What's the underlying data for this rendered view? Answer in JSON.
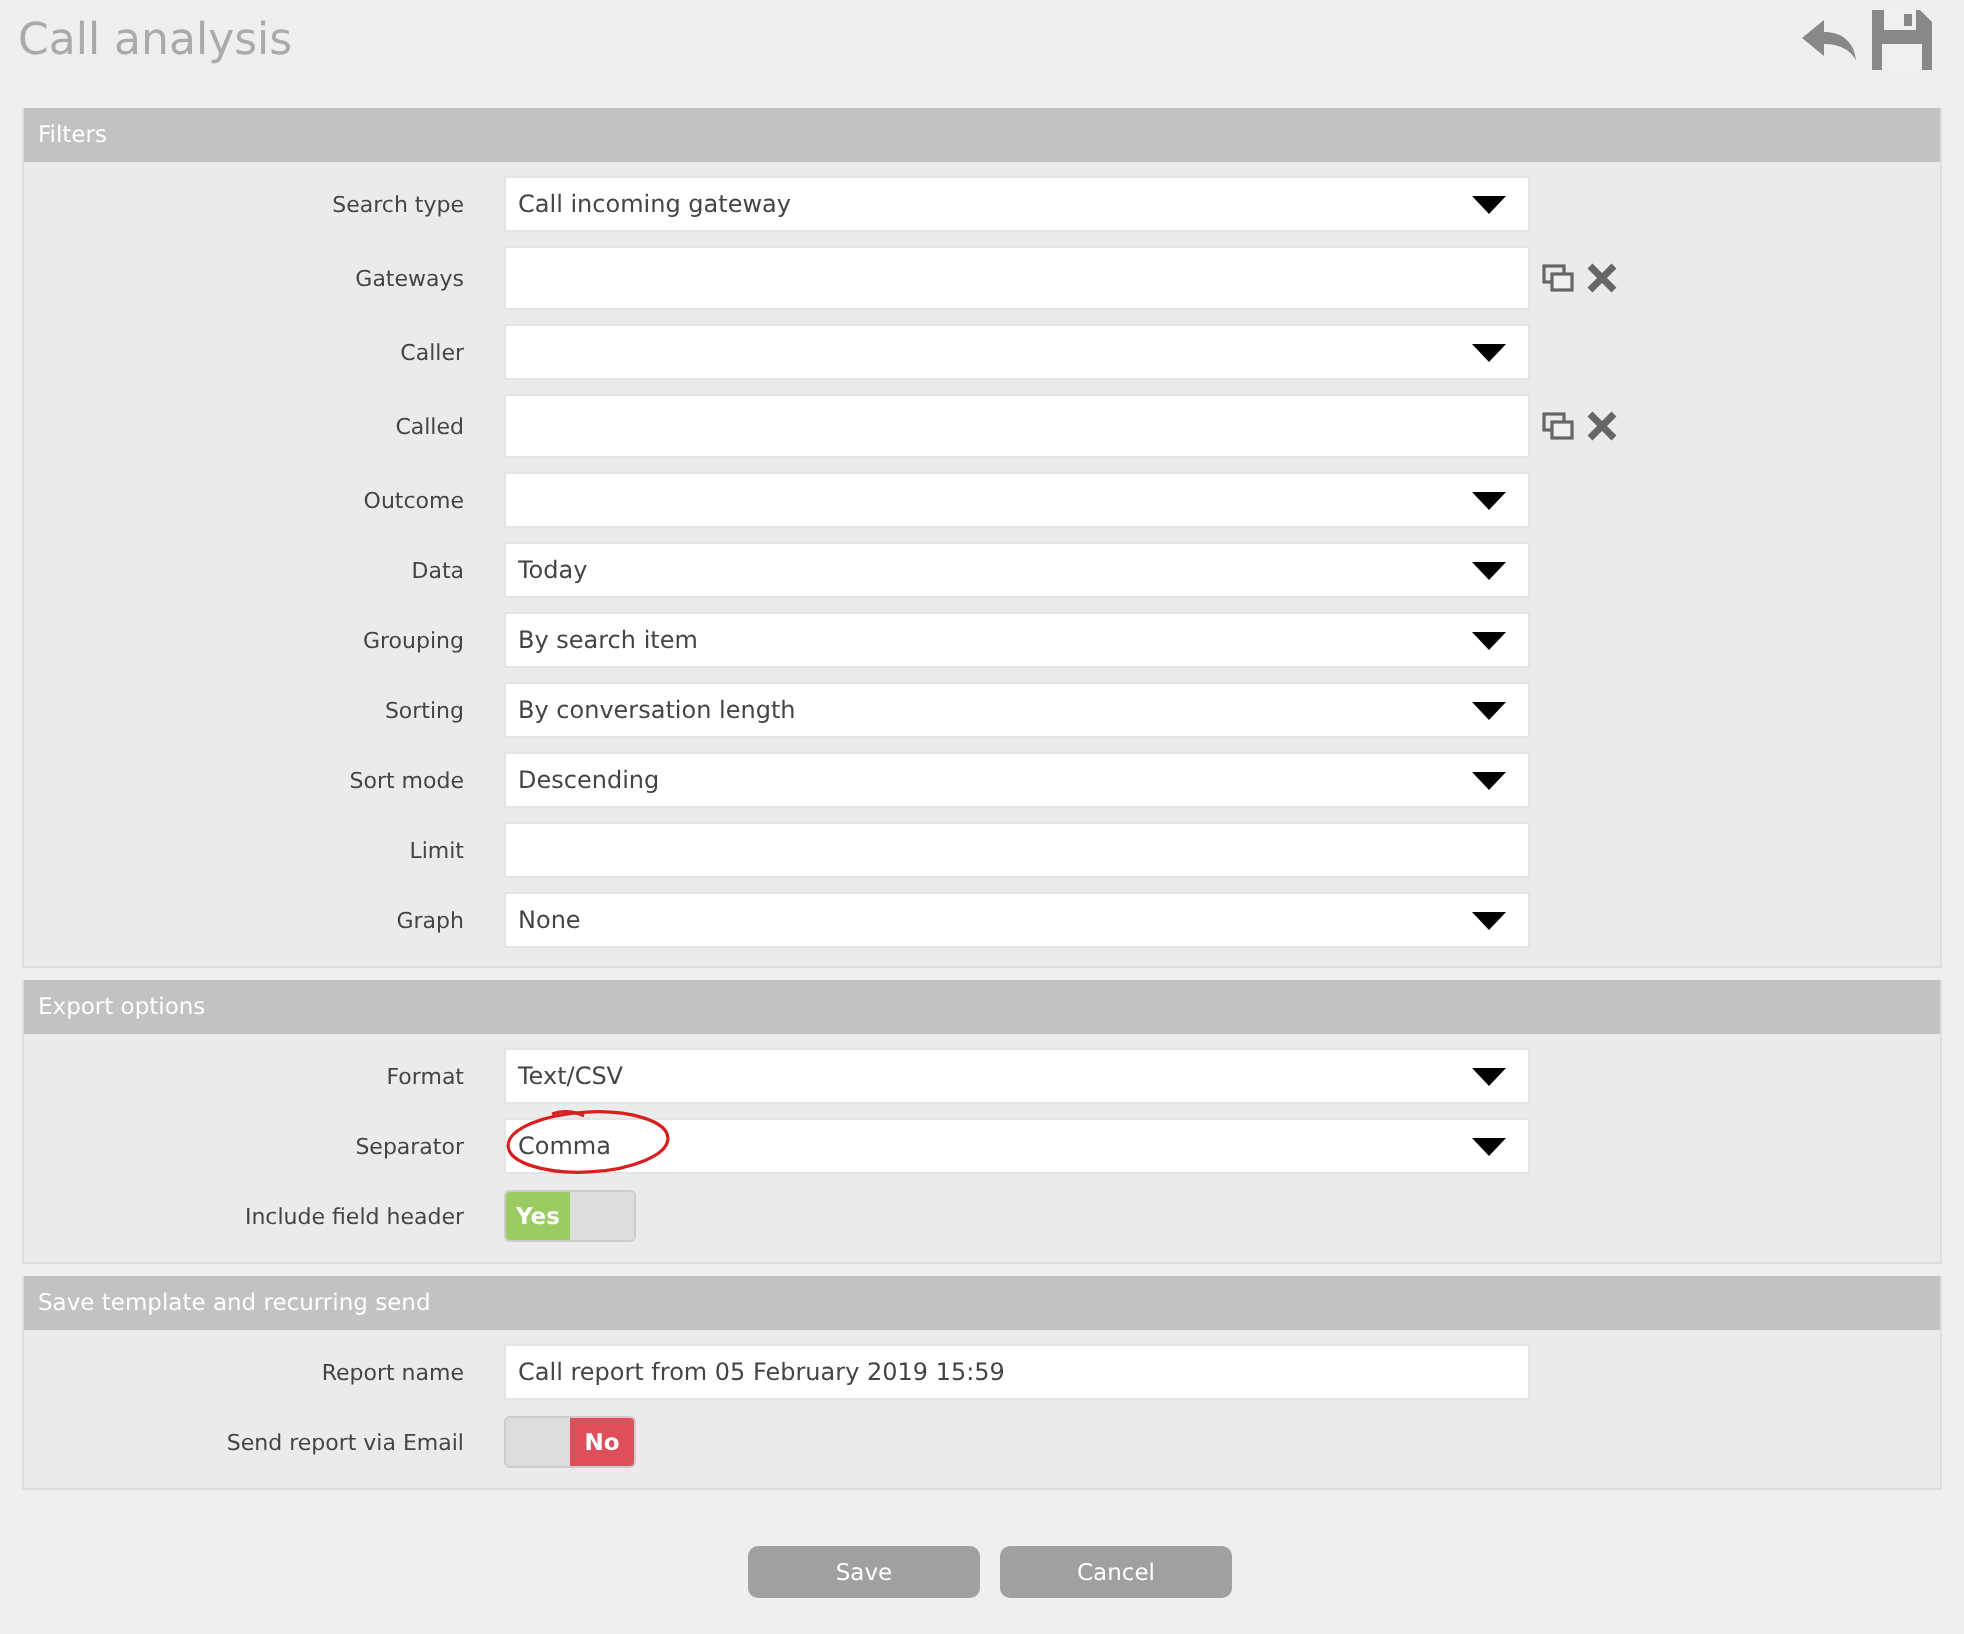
{
  "page": {
    "title": "Call analysis"
  },
  "sections": [
    {
      "title": "Filters",
      "fields": [
        {
          "label": "Search type",
          "kind": "select",
          "value": "Call incoming gateway"
        },
        {
          "label": "Gateways",
          "kind": "multi"
        },
        {
          "label": "Caller",
          "kind": "select"
        },
        {
          "label": "Called",
          "kind": "multi"
        },
        {
          "label": "Outcome",
          "kind": "select"
        },
        {
          "label": "Data",
          "kind": "select",
          "value": "Today"
        },
        {
          "label": "Grouping",
          "kind": "select",
          "value": "By search item"
        },
        {
          "label": "Sorting",
          "kind": "select",
          "value": "By conversation length"
        },
        {
          "label": "Sort mode",
          "kind": "select",
          "value": "Descending"
        },
        {
          "label": "Limit",
          "kind": "text"
        },
        {
          "label": "Graph",
          "kind": "select",
          "value": "None"
        }
      ]
    },
    {
      "title": "Export options",
      "fields": [
        {
          "label": "Format",
          "kind": "select",
          "value": "Text/CSV"
        },
        {
          "label": "Separator",
          "kind": "select",
          "value": "Comma",
          "circled": true
        },
        {
          "label": "Include field header",
          "kind": "toggle",
          "on": true,
          "value": "Yes"
        }
      ]
    },
    {
      "title": "Save template and recurring send",
      "fields": [
        {
          "label": "Report name",
          "kind": "text",
          "value": "Call report from 05 February 2019 15:59"
        },
        {
          "label": "Send report via Email",
          "kind": "toggle",
          "on": false,
          "value": "No"
        }
      ]
    }
  ],
  "buttons": [
    "Save",
    "Cancel"
  ]
}
